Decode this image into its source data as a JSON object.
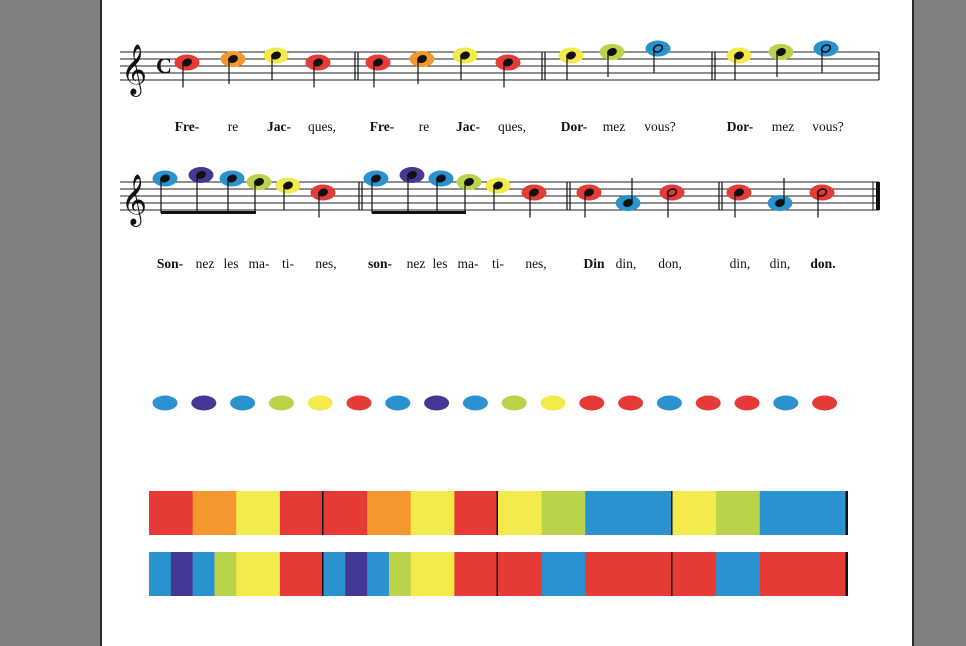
{
  "colors": {
    "red": "#e53a35",
    "orange": "#f5972f",
    "yellow": "#f4ea4b",
    "lime": "#b9d34a",
    "blue": "#2a93cf",
    "purple": "#443895",
    "page": "#ffffff",
    "background": "#808080"
  },
  "clef": "treble-clef",
  "time_signature": "C",
  "line1_notes": [
    {
      "color": "red",
      "pitch": "C5",
      "dur": "quarter"
    },
    {
      "color": "orange",
      "pitch": "D5",
      "dur": "quarter"
    },
    {
      "color": "yellow",
      "pitch": "E5",
      "dur": "quarter"
    },
    {
      "color": "red",
      "pitch": "C5",
      "dur": "quarter"
    },
    {
      "color": "red",
      "pitch": "C5",
      "dur": "quarter"
    },
    {
      "color": "orange",
      "pitch": "D5",
      "dur": "quarter"
    },
    {
      "color": "yellow",
      "pitch": "E5",
      "dur": "quarter"
    },
    {
      "color": "red",
      "pitch": "C5",
      "dur": "quarter"
    },
    {
      "color": "yellow",
      "pitch": "E5",
      "dur": "quarter"
    },
    {
      "color": "lime",
      "pitch": "F5",
      "dur": "quarter"
    },
    {
      "color": "blue",
      "pitch": "G5",
      "dur": "half"
    },
    {
      "color": "yellow",
      "pitch": "E5",
      "dur": "quarter"
    },
    {
      "color": "lime",
      "pitch": "F5",
      "dur": "quarter"
    },
    {
      "color": "blue",
      "pitch": "G5",
      "dur": "half"
    }
  ],
  "line2_notes": [
    {
      "color": "blue",
      "pitch": "G5",
      "dur": "eighth"
    },
    {
      "color": "purple",
      "pitch": "A5",
      "dur": "eighth"
    },
    {
      "color": "blue",
      "pitch": "G5",
      "dur": "eighth"
    },
    {
      "color": "lime",
      "pitch": "F5",
      "dur": "eighth"
    },
    {
      "color": "yellow",
      "pitch": "E5",
      "dur": "quarter"
    },
    {
      "color": "red",
      "pitch": "C5",
      "dur": "quarter"
    },
    {
      "color": "blue",
      "pitch": "G5",
      "dur": "eighth"
    },
    {
      "color": "purple",
      "pitch": "A5",
      "dur": "eighth"
    },
    {
      "color": "blue",
      "pitch": "G5",
      "dur": "eighth"
    },
    {
      "color": "lime",
      "pitch": "F5",
      "dur": "eighth"
    },
    {
      "color": "yellow",
      "pitch": "E5",
      "dur": "quarter"
    },
    {
      "color": "red",
      "pitch": "C5",
      "dur": "quarter"
    },
    {
      "color": "red",
      "pitch": "C5",
      "dur": "quarter"
    },
    {
      "color": "blue",
      "pitch": "G4",
      "dur": "quarter"
    },
    {
      "color": "red",
      "pitch": "C5",
      "dur": "half"
    },
    {
      "color": "red",
      "pitch": "C5",
      "dur": "quarter"
    },
    {
      "color": "blue",
      "pitch": "G4",
      "dur": "quarter"
    },
    {
      "color": "red",
      "pitch": "C5",
      "dur": "half"
    }
  ],
  "line1_lyrics": [
    {
      "text": "Fre-",
      "bold": true
    },
    {
      "text": "re",
      "bold": false
    },
    {
      "text": "Jac-",
      "bold": true
    },
    {
      "text": "ques,",
      "bold": false
    },
    {
      "text": "Fre-",
      "bold": true
    },
    {
      "text": "re",
      "bold": false
    },
    {
      "text": "Jac-",
      "bold": true
    },
    {
      "text": "ques,",
      "bold": false
    },
    {
      "text": "Dor-",
      "bold": true
    },
    {
      "text": "mez",
      "bold": false
    },
    {
      "text": "vous?",
      "bold": false
    },
    {
      "text": "Dor-",
      "bold": true
    },
    {
      "text": "mez",
      "bold": false
    },
    {
      "text": "vous?",
      "bold": false
    }
  ],
  "line2_lyrics": [
    {
      "text": "Son-",
      "bold": true
    },
    {
      "text": "nez",
      "bold": false
    },
    {
      "text": "les",
      "bold": false
    },
    {
      "text": "ma-",
      "bold": false
    },
    {
      "text": "ti-",
      "bold": false
    },
    {
      "text": "nes,",
      "bold": false
    },
    {
      "text": "son-",
      "bold": true
    },
    {
      "text": "nez",
      "bold": false
    },
    {
      "text": "les",
      "bold": false
    },
    {
      "text": "ma-",
      "bold": false
    },
    {
      "text": "ti-",
      "bold": false
    },
    {
      "text": "nes,",
      "bold": false
    },
    {
      "text": "Din",
      "bold": true
    },
    {
      "text": "din,",
      "bold": false
    },
    {
      "text": "don,",
      "bold": false
    },
    {
      "text": "din,",
      "bold": false
    },
    {
      "text": "din,",
      "bold": false
    },
    {
      "text": "don.",
      "bold": true
    }
  ],
  "dot_sequence": [
    "blue",
    "purple",
    "blue",
    "lime",
    "yellow",
    "red",
    "blue",
    "purple",
    "blue",
    "lime",
    "yellow",
    "red",
    "red",
    "blue",
    "red",
    "red",
    "blue",
    "red"
  ],
  "bar_rows": [
    [
      {
        "color": "red",
        "beats": 1
      },
      {
        "color": "orange",
        "beats": 1
      },
      {
        "color": "yellow",
        "beats": 1
      },
      {
        "color": "red",
        "beats": 1,
        "barline": true
      },
      {
        "color": "red",
        "beats": 1
      },
      {
        "color": "orange",
        "beats": 1
      },
      {
        "color": "yellow",
        "beats": 1
      },
      {
        "color": "red",
        "beats": 1,
        "barline": true
      },
      {
        "color": "yellow",
        "beats": 1
      },
      {
        "color": "lime",
        "beats": 1
      },
      {
        "color": "blue",
        "beats": 2,
        "barline": true
      },
      {
        "color": "yellow",
        "beats": 1
      },
      {
        "color": "lime",
        "beats": 1
      },
      {
        "color": "blue",
        "beats": 2,
        "barline": true
      }
    ],
    [
      {
        "color": "blue",
        "beats": 0.5
      },
      {
        "color": "purple",
        "beats": 0.5
      },
      {
        "color": "blue",
        "beats": 0.5
      },
      {
        "color": "lime",
        "beats": 0.5
      },
      {
        "color": "yellow",
        "beats": 1
      },
      {
        "color": "red",
        "beats": 1,
        "barline": true
      },
      {
        "color": "blue",
        "beats": 0.5
      },
      {
        "color": "purple",
        "beats": 0.5
      },
      {
        "color": "blue",
        "beats": 0.5
      },
      {
        "color": "lime",
        "beats": 0.5
      },
      {
        "color": "yellow",
        "beats": 1
      },
      {
        "color": "red",
        "beats": 1,
        "barline": true
      },
      {
        "color": "red",
        "beats": 1
      },
      {
        "color": "blue",
        "beats": 1
      },
      {
        "color": "red",
        "beats": 2,
        "barline": true
      },
      {
        "color": "red",
        "beats": 1
      },
      {
        "color": "blue",
        "beats": 1
      },
      {
        "color": "red",
        "beats": 2,
        "barline": true
      }
    ]
  ]
}
